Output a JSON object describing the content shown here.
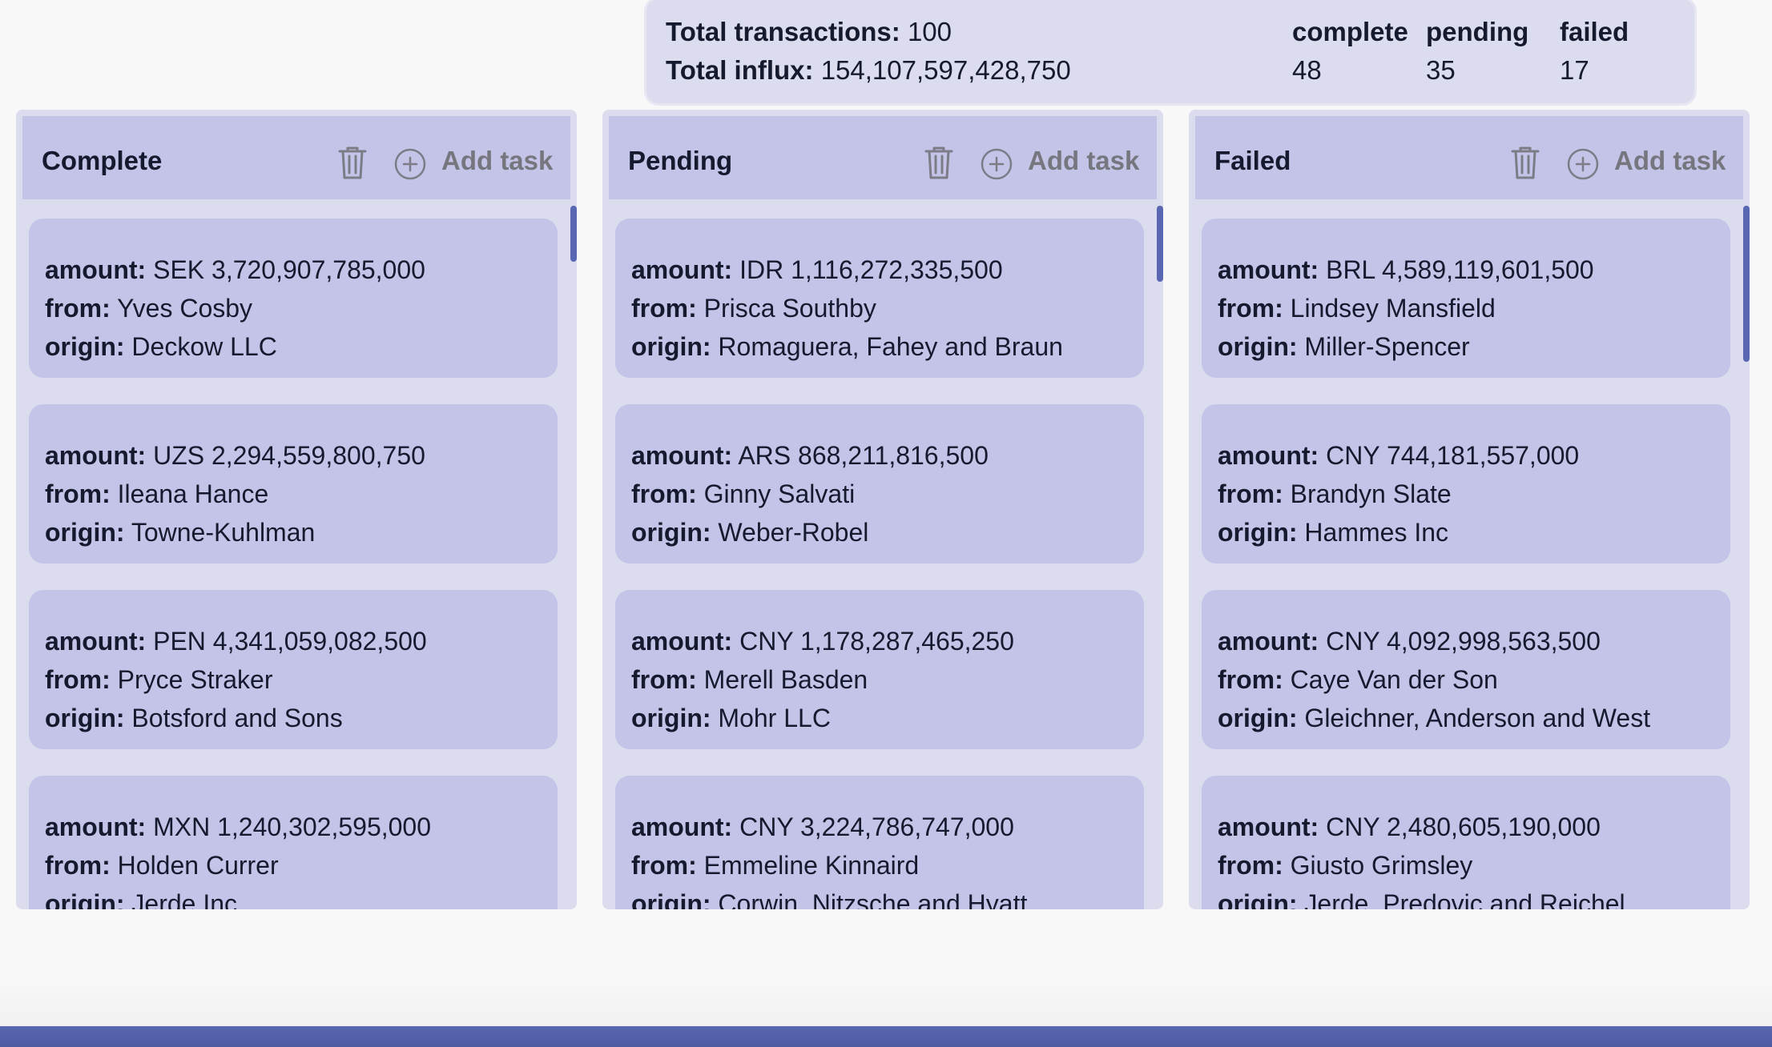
{
  "summary": {
    "total_transactions_label": "Total transactions:",
    "total_transactions_value": "100",
    "total_influx_label": "Total influx:",
    "total_influx_value": "154,107,597,428,750",
    "stats": [
      {
        "label": "complete",
        "value": "48"
      },
      {
        "label": "pending",
        "value": "35"
      },
      {
        "label": "failed",
        "value": "17"
      }
    ]
  },
  "labels": {
    "amount": "amount:",
    "from": "from:",
    "origin": "origin:"
  },
  "columns": [
    {
      "title": "Complete",
      "add_label": "Add task",
      "cards": [
        {
          "amount": "SEK 3,720,907,785,000",
          "from": "Yves Cosby",
          "origin": "Deckow LLC"
        },
        {
          "amount": "UZS 2,294,559,800,750",
          "from": "Ileana Hance",
          "origin": "Towne-Kuhlman"
        },
        {
          "amount": "PEN 4,341,059,082,500",
          "from": "Pryce Straker",
          "origin": "Botsford and Sons"
        },
        {
          "amount": "MXN 1,240,302,595,000",
          "from": "Holden Currer",
          "origin": "Jerde Inc"
        }
      ]
    },
    {
      "title": "Pending",
      "add_label": "Add task",
      "cards": [
        {
          "amount": "IDR 1,116,272,335,500",
          "from": "Prisca Southby",
          "origin": "Romaguera, Fahey and Braun"
        },
        {
          "amount": "ARS 868,211,816,500",
          "from": "Ginny Salvati",
          "origin": "Weber-Robel"
        },
        {
          "amount": "CNY 1,178,287,465,250",
          "from": "Merell Basden",
          "origin": "Mohr LLC"
        },
        {
          "amount": "CNY 3,224,786,747,000",
          "from": "Emmeline Kinnaird",
          "origin": "Corwin, Nitzsche and Hyatt"
        }
      ]
    },
    {
      "title": "Failed",
      "add_label": "Add task",
      "cards": [
        {
          "amount": "BRL 4,589,119,601,500",
          "from": "Lindsey Mansfield",
          "origin": "Miller-Spencer"
        },
        {
          "amount": "CNY 744,181,557,000",
          "from": "Brandyn Slate",
          "origin": "Hammes Inc"
        },
        {
          "amount": "CNY 4,092,998,563,500",
          "from": "Caye Van der Son",
          "origin": "Gleichner, Anderson and West"
        },
        {
          "amount": "CNY 2,480,605,190,000",
          "from": "Giusto Grimsley",
          "origin": "Jerde, Predovic and Reichel"
        }
      ]
    }
  ],
  "icons": {
    "delete": "trash-icon",
    "add": "plus-circle-icon"
  },
  "colors": {
    "panel": "#dcdcef",
    "card": "#c4c4e9",
    "accent": "#5967b3",
    "muted": "#76767f"
  }
}
